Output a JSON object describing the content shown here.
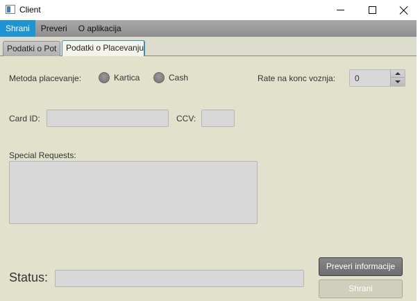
{
  "window": {
    "title": "Client"
  },
  "menu": {
    "items": [
      {
        "label": "Shrani",
        "active": true
      },
      {
        "label": "Preveri",
        "active": false
      },
      {
        "label": "O aplikacija",
        "active": false
      }
    ]
  },
  "tabs": [
    {
      "label": "Podatki o Pot",
      "selected": false
    },
    {
      "label": "Podatki o Placevanju",
      "selected": true
    }
  ],
  "payment": {
    "method_label": "Metoda placevanje:",
    "options": [
      "Kartica",
      "Cash"
    ],
    "rate_label": "Rate na konc voznja:",
    "rate_value": "0"
  },
  "card": {
    "card_id_label": "Card ID:",
    "card_id_value": "",
    "ccv_label": "CCV:",
    "ccv_value": ""
  },
  "special": {
    "label": "Special Requests:",
    "value": ""
  },
  "status": {
    "label": "Status:",
    "value": ""
  },
  "buttons": {
    "preveri": "Preveri informacije",
    "shrani": "Shrani"
  },
  "colors": {
    "menu_active": "#1e94d2",
    "panel_bg": "#e2e2cc"
  }
}
